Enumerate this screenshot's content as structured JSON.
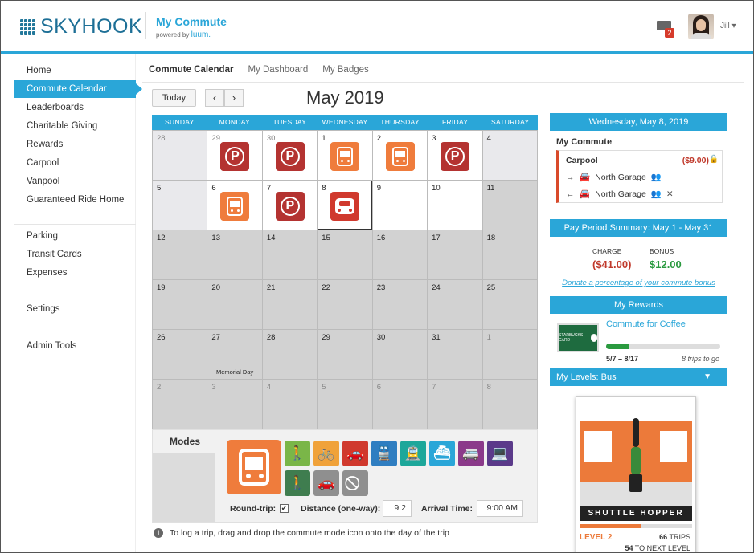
{
  "header": {
    "brand": "SKYHOOK",
    "app_title": "My Commute",
    "powered_by": "powered by",
    "powered_brand": "luum.",
    "mail_count": "2",
    "user_name": "Jill"
  },
  "sidebar": {
    "items": [
      {
        "label": "Home",
        "active": false
      },
      {
        "label": "Commute Calendar",
        "active": true
      },
      {
        "label": "Leaderboards",
        "active": false
      },
      {
        "label": "Charitable Giving",
        "active": false
      },
      {
        "label": "Rewards",
        "active": false
      },
      {
        "label": "Carpool",
        "active": false
      },
      {
        "label": "Vanpool",
        "active": false
      },
      {
        "label": "Guaranteed Ride Home",
        "active": false
      }
    ],
    "items2": [
      {
        "label": "Parking"
      },
      {
        "label": "Transit Cards"
      },
      {
        "label": "Expenses"
      }
    ],
    "settings": "Settings",
    "admin": "Admin Tools"
  },
  "tabs": [
    "Commute Calendar",
    "My Dashboard",
    "My Badges"
  ],
  "calendar": {
    "today_label": "Today",
    "prev_arrow": "‹",
    "next_arrow": "›",
    "month_title": "May 2019",
    "weekdays": [
      "SUNDAY",
      "MONDAY",
      "TUESDAY",
      "WEDNESDAY",
      "THURSDAY",
      "FRIDAY",
      "SATURDAY"
    ],
    "days": [
      {
        "n": "28",
        "style": "lightgray",
        "other": true,
        "icon": ""
      },
      {
        "n": "29",
        "style": "white",
        "other": true,
        "icon": "park"
      },
      {
        "n": "30",
        "style": "white",
        "other": true,
        "icon": "park"
      },
      {
        "n": "1",
        "style": "white",
        "other": false,
        "icon": "bus"
      },
      {
        "n": "2",
        "style": "white",
        "other": false,
        "icon": "bus"
      },
      {
        "n": "3",
        "style": "white",
        "other": false,
        "icon": "park"
      },
      {
        "n": "4",
        "style": "lightgray",
        "other": false,
        "icon": ""
      },
      {
        "n": "5",
        "style": "lightgray",
        "other": false,
        "icon": ""
      },
      {
        "n": "6",
        "style": "white",
        "other": false,
        "icon": "bus"
      },
      {
        "n": "7",
        "style": "white",
        "other": false,
        "icon": "park"
      },
      {
        "n": "8",
        "style": "selected",
        "other": false,
        "icon": "car"
      },
      {
        "n": "9",
        "style": "white",
        "other": false,
        "icon": ""
      },
      {
        "n": "10",
        "style": "white",
        "other": false,
        "icon": ""
      },
      {
        "n": "11",
        "style": "gray",
        "other": false,
        "icon": ""
      },
      {
        "n": "12",
        "style": "gray",
        "other": false,
        "icon": ""
      },
      {
        "n": "13",
        "style": "gray",
        "other": false,
        "icon": ""
      },
      {
        "n": "14",
        "style": "gray",
        "other": false,
        "icon": ""
      },
      {
        "n": "15",
        "style": "gray",
        "other": false,
        "icon": ""
      },
      {
        "n": "16",
        "style": "gray",
        "other": false,
        "icon": ""
      },
      {
        "n": "17",
        "style": "gray",
        "other": false,
        "icon": ""
      },
      {
        "n": "18",
        "style": "gray",
        "other": false,
        "icon": ""
      },
      {
        "n": "19",
        "style": "gray",
        "other": false,
        "icon": ""
      },
      {
        "n": "20",
        "style": "gray",
        "other": false,
        "icon": ""
      },
      {
        "n": "21",
        "style": "gray",
        "other": false,
        "icon": ""
      },
      {
        "n": "22",
        "style": "gray",
        "other": false,
        "icon": ""
      },
      {
        "n": "23",
        "style": "gray",
        "other": false,
        "icon": ""
      },
      {
        "n": "24",
        "style": "gray",
        "other": false,
        "icon": ""
      },
      {
        "n": "25",
        "style": "gray",
        "other": false,
        "icon": ""
      },
      {
        "n": "26",
        "style": "gray",
        "other": false,
        "icon": ""
      },
      {
        "n": "27",
        "style": "gray",
        "other": false,
        "icon": "",
        "note": "Memorial Day"
      },
      {
        "n": "28",
        "style": "gray",
        "other": false,
        "icon": ""
      },
      {
        "n": "29",
        "style": "gray",
        "other": false,
        "icon": ""
      },
      {
        "n": "30",
        "style": "gray",
        "other": false,
        "icon": ""
      },
      {
        "n": "31",
        "style": "gray",
        "other": false,
        "icon": ""
      },
      {
        "n": "1",
        "style": "gray",
        "other": true,
        "icon": ""
      },
      {
        "n": "2",
        "style": "gray",
        "other": true,
        "icon": ""
      },
      {
        "n": "3",
        "style": "gray",
        "other": true,
        "icon": ""
      },
      {
        "n": "4",
        "style": "gray",
        "other": true,
        "icon": ""
      },
      {
        "n": "5",
        "style": "gray",
        "other": true,
        "icon": ""
      },
      {
        "n": "6",
        "style": "gray",
        "other": true,
        "icon": ""
      },
      {
        "n": "7",
        "style": "gray",
        "other": true,
        "icon": ""
      },
      {
        "n": "8",
        "style": "gray",
        "other": true,
        "icon": ""
      }
    ]
  },
  "modes": {
    "label": "Modes",
    "selected": "bus",
    "icons": [
      {
        "name": "walk",
        "color": "#7ab648",
        "glyph": "🚶"
      },
      {
        "name": "bike",
        "color": "#f0a23a",
        "glyph": "🚲"
      },
      {
        "name": "drive-alone",
        "color": "#d0392d",
        "glyph": "🚗"
      },
      {
        "name": "train",
        "color": "#2f7ec1",
        "glyph": "🚆"
      },
      {
        "name": "light-rail",
        "color": "#1da79a",
        "glyph": "🚊"
      },
      {
        "name": "ferry",
        "color": "#2aa6d8",
        "glyph": "⛴"
      },
      {
        "name": "vanpool",
        "color": "#8b3a8a",
        "glyph": "🚐"
      },
      {
        "name": "telework",
        "color": "#5b3a8a",
        "glyph": "💻"
      },
      {
        "name": "walk-to-car",
        "color": "#3f7d4f",
        "glyph": "🚶"
      },
      {
        "name": "carpool",
        "color": "#8f8f8f",
        "glyph": "🚗"
      },
      {
        "name": "no-commute",
        "color": "#8f8f8f",
        "glyph": "⃠"
      }
    ],
    "round_trip_label": "Round-trip:",
    "round_trip_checked": "✔",
    "distance_label": "Distance (one-way):",
    "distance_value": "9.2",
    "arrival_label": "Arrival Time:",
    "arrival_value": "9:00 AM"
  },
  "info": "To log a trip, drag and drop the commute mode icon onto the day of the trip",
  "right": {
    "date_header": "Wednesday, May 8, 2019",
    "my_commute": "My Commute",
    "mode": "Carpool",
    "cost": "($9.00)",
    "trips": [
      {
        "dir": "→",
        "place": "North Garage",
        "extra": ""
      },
      {
        "dir": "←",
        "place": "North Garage",
        "extra": "✕"
      }
    ],
    "pay_header": "Pay Period Summary: May 1 - May 31",
    "charge_label": "CHARGE",
    "charge_value": "($41.00)",
    "bonus_label": "BONUS",
    "bonus_value": "$12.00",
    "donate_link": "Donate a percentage of your commute bonus",
    "rewards_header": "My Rewards",
    "reward_name": "Commute for Coffee",
    "reward_card_text": "STARBUCKS CARD",
    "reward_dates": "5/7 – 8/17",
    "reward_togo": "8 trips to go",
    "reward_progress": 0.2,
    "levels_header": "My Levels:  Bus",
    "badge_title": "SHUTTLE HOPPER",
    "level_label": "LEVEL 2",
    "level_trips": "66",
    "level_trips_label": "TRIPS",
    "to_next": "54",
    "to_next_label": "TO NEXT LEVEL",
    "level_progress": 0.55
  }
}
